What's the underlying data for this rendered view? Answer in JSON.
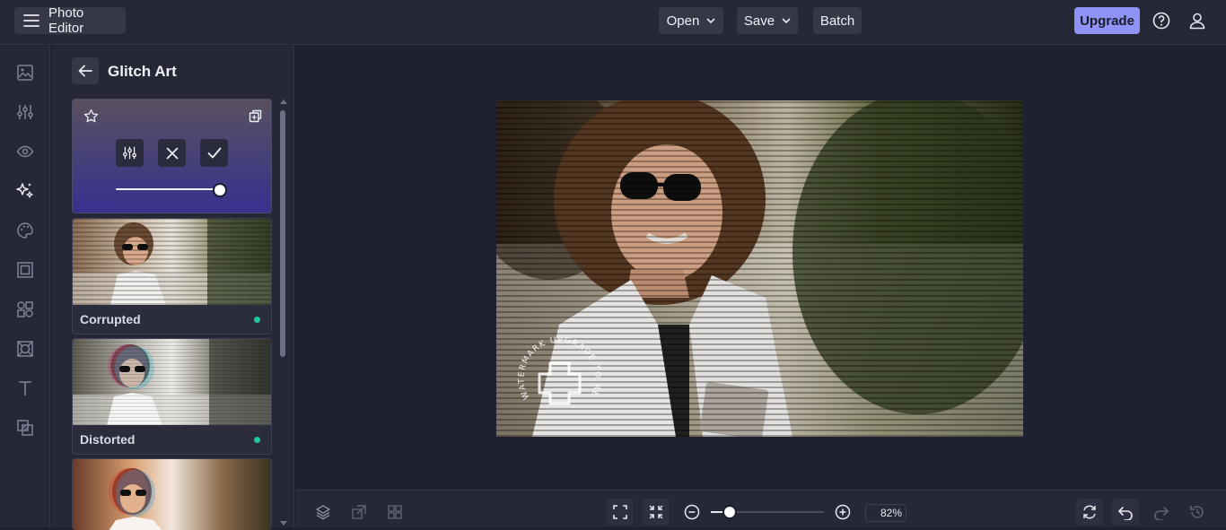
{
  "header": {
    "app_title": "Photo Editor",
    "menu": {
      "open_label": "Open",
      "save_label": "Save",
      "batch_label": "Batch"
    },
    "upgrade_label": "Upgrade"
  },
  "rail": {
    "icons": [
      "image-icon",
      "sliders-icon",
      "eye-icon",
      "sparkles-icon",
      "palette-icon",
      "frame-icon",
      "shapes-icon",
      "texture-icon",
      "text-icon",
      "overlay-icon"
    ]
  },
  "panel": {
    "title": "Glitch Art",
    "effects": [
      {
        "label": "Corrupted",
        "active": true
      },
      {
        "label": "Distorted",
        "active": true
      }
    ],
    "intensity": 1.0
  },
  "canvas": {
    "watermark_text": "WATERMARK UPGRADE TO REMOVE"
  },
  "bottom": {
    "zoom_label": "82%",
    "zoom_value": 0.82
  },
  "colors": {
    "accent": "#8f93f5",
    "status_dot": "#1fc7a2",
    "background": "#1f2130",
    "panel": "#262837"
  }
}
